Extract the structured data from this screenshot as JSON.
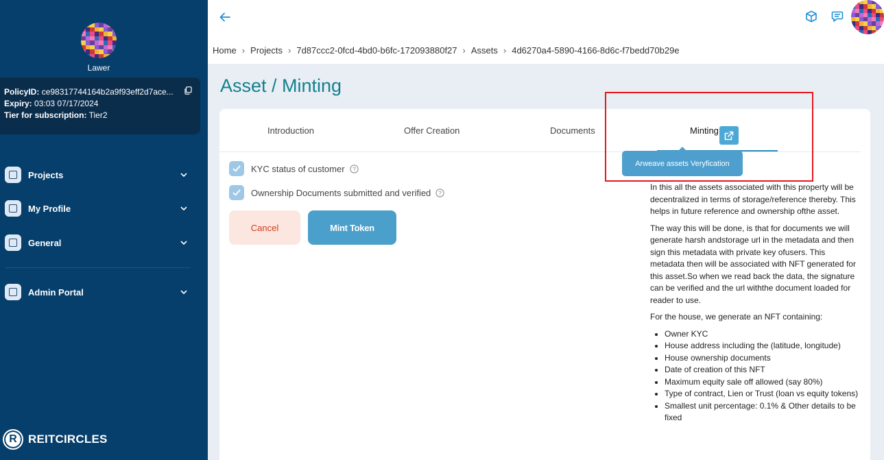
{
  "sidebar": {
    "user_name": "Lawer",
    "policy": {
      "policy_label": "PolicyID:",
      "policy_value": "ce98317744164b2a9f93eff2d7ace...",
      "expiry_label": "Expiry:",
      "expiry_value": "03:03 07/17/2024",
      "tier_label": "Tier for subscription:",
      "tier_value": "Tier2"
    },
    "items": [
      {
        "label": "Projects"
      },
      {
        "label": "My Profile"
      },
      {
        "label": "General"
      },
      {
        "label": "Admin Portal"
      }
    ],
    "brand": {
      "logo_letter": "R",
      "name": "REITCIRCLES"
    }
  },
  "breadcrumb": [
    "Home",
    "Projects",
    "7d87ccc2-0fcd-4bd0-b6fc-172093880f27",
    "Assets",
    "4d6270a4-5890-4166-8d6c-f7bedd70b29e"
  ],
  "page_title": "Asset / Minting",
  "tabs": [
    {
      "label": "Introduction"
    },
    {
      "label": "Offer Creation"
    },
    {
      "label": "Documents"
    },
    {
      "label": "Minting",
      "active": true
    }
  ],
  "tooltip": "Arweave assets Veryfication",
  "checks": [
    {
      "label": "KYC status of customer",
      "checked": true
    },
    {
      "label": "Ownership Documents submitted and verified",
      "checked": true
    }
  ],
  "buttons": {
    "cancel": "Cancel",
    "mint": "Mint Token"
  },
  "info": {
    "p1": "In this all the assets associated with this property will be decentralized in terms of storage/reference thereby. This helps in future reference and ownership ofthe asset.",
    "p2": "The way this will be done, is that for documents we will generate harsh andstorage url in the metadata and then sign this metadata with private key ofusers. This metadata then will be associated with NFT generated for this asset.So when we read back the data, the signature can be verified and the url withthe document loaded for reader to use.",
    "p3": "For the house, we generate an NFT containing:",
    "list": [
      "Owner KYC",
      "House address including the (latitude, longitude)",
      "House ownership documents",
      "Date of creation of this NFT",
      "Maximum equity sale off allowed (say 80%)",
      "Type of contract, Lien or Trust (loan vs equity tokens)",
      "Smallest unit percentage: 0.1% & Other details to be fixed"
    ]
  },
  "colors": {
    "sidebar": "#063f6b",
    "accent_title": "#12818c",
    "primary_button": "#4b9fcb",
    "highlight_box": "#e5161b"
  }
}
